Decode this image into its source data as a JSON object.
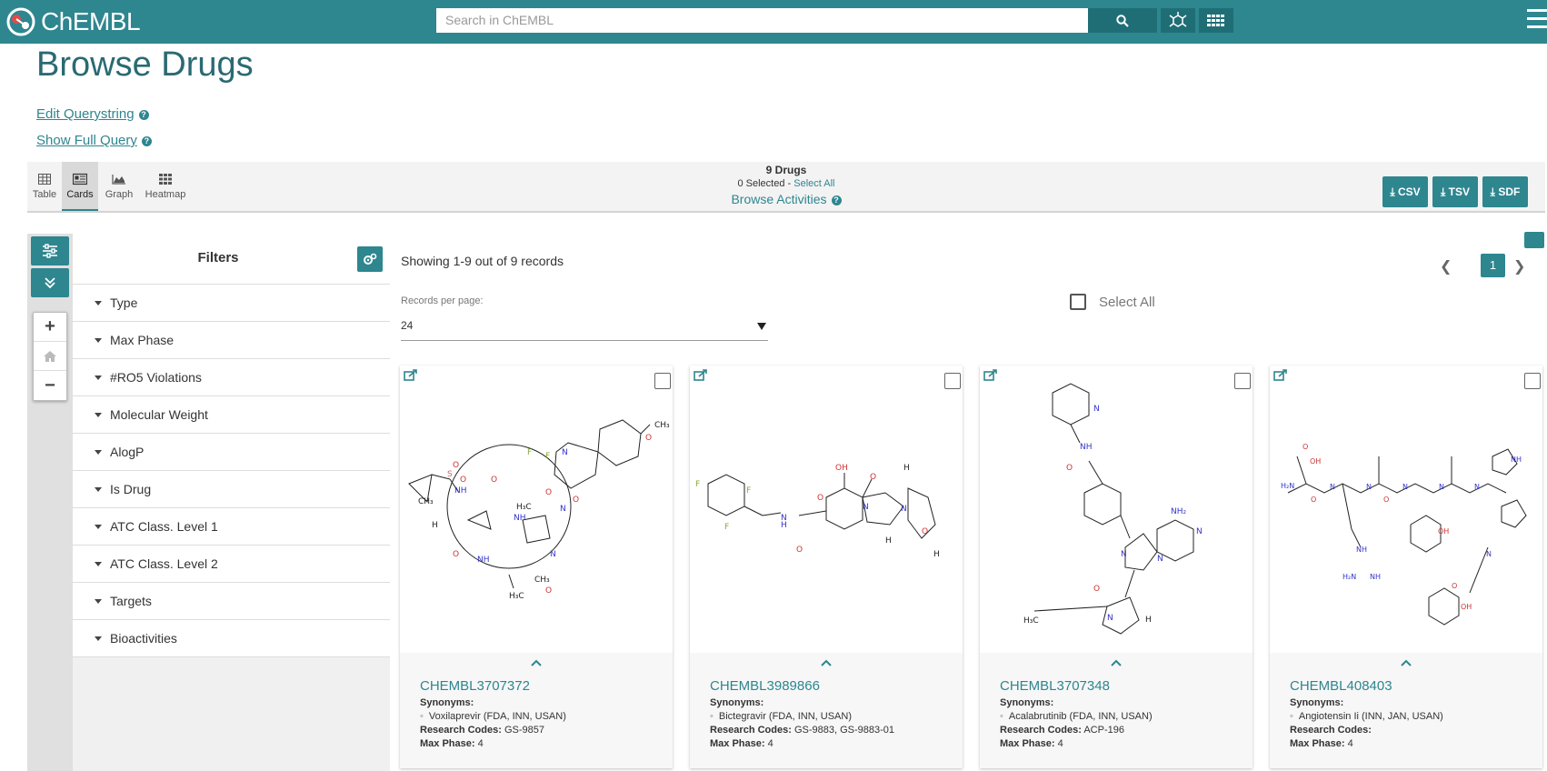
{
  "app": {
    "brand": "ChEMBL",
    "search_placeholder": "Search in ChEMBL"
  },
  "page": {
    "title": "Browse Drugs",
    "links": {
      "edit_querystring": "Edit Querystring",
      "show_full_query": "Show Full Query"
    }
  },
  "views": [
    {
      "label": "Table",
      "icon": "table-icon",
      "active": false
    },
    {
      "label": "Cards",
      "icon": "cards-icon",
      "active": true
    },
    {
      "label": "Graph",
      "icon": "graph-icon",
      "active": false
    },
    {
      "label": "Heatmap",
      "icon": "heatmap-icon",
      "active": false
    }
  ],
  "summary": {
    "count_label": "9 Drugs",
    "selected_label": "0 Selected - ",
    "select_all_link": "Select All",
    "browse_activities": "Browse Activities"
  },
  "downloads": [
    "CSV",
    "TSV",
    "SDF"
  ],
  "filters": {
    "title": "Filters",
    "items": [
      "Type",
      "Max Phase",
      "#RO5 Violations",
      "Molecular Weight",
      "AlogP",
      "Is Drug",
      "ATC Class. Level 1",
      "ATC Class. Level 2",
      "Targets",
      "Bioactivities"
    ]
  },
  "results": {
    "showing": "Showing 1-9 out of 9 records",
    "current_page": "1",
    "records_per_page_label": "Records per page:",
    "records_per_page_value": "24",
    "select_all": "Select All"
  },
  "cards": [
    {
      "id": "CHEMBL3707372",
      "synonyms_label": "Synonyms:",
      "synonym": "Voxilaprevir (FDA, INN, USAN)",
      "codes_label": "Research Codes:",
      "codes": "GS-9857",
      "phase_label": "Max Phase:",
      "phase": "4"
    },
    {
      "id": "CHEMBL3989866",
      "synonyms_label": "Synonyms:",
      "synonym": "Bictegravir (FDA, INN, USAN)",
      "codes_label": "Research Codes:",
      "codes": "GS-9883, GS-9883-01",
      "phase_label": "Max Phase:",
      "phase": "4"
    },
    {
      "id": "CHEMBL3707348",
      "synonyms_label": "Synonyms:",
      "synonym": "Acalabrutinib (FDA, INN, USAN)",
      "codes_label": "Research Codes:",
      "codes": "ACP-196",
      "phase_label": "Max Phase:",
      "phase": "4"
    },
    {
      "id": "CHEMBL408403",
      "synonyms_label": "Synonyms:",
      "synonym": "Angiotensin Ii (INN, JAN, USAN)",
      "codes_label": "Research Codes:",
      "codes": "",
      "phase_label": "Max Phase:",
      "phase": "4"
    }
  ],
  "colors": {
    "brand": "#2e868f",
    "brand_dark": "#1f6e76"
  }
}
